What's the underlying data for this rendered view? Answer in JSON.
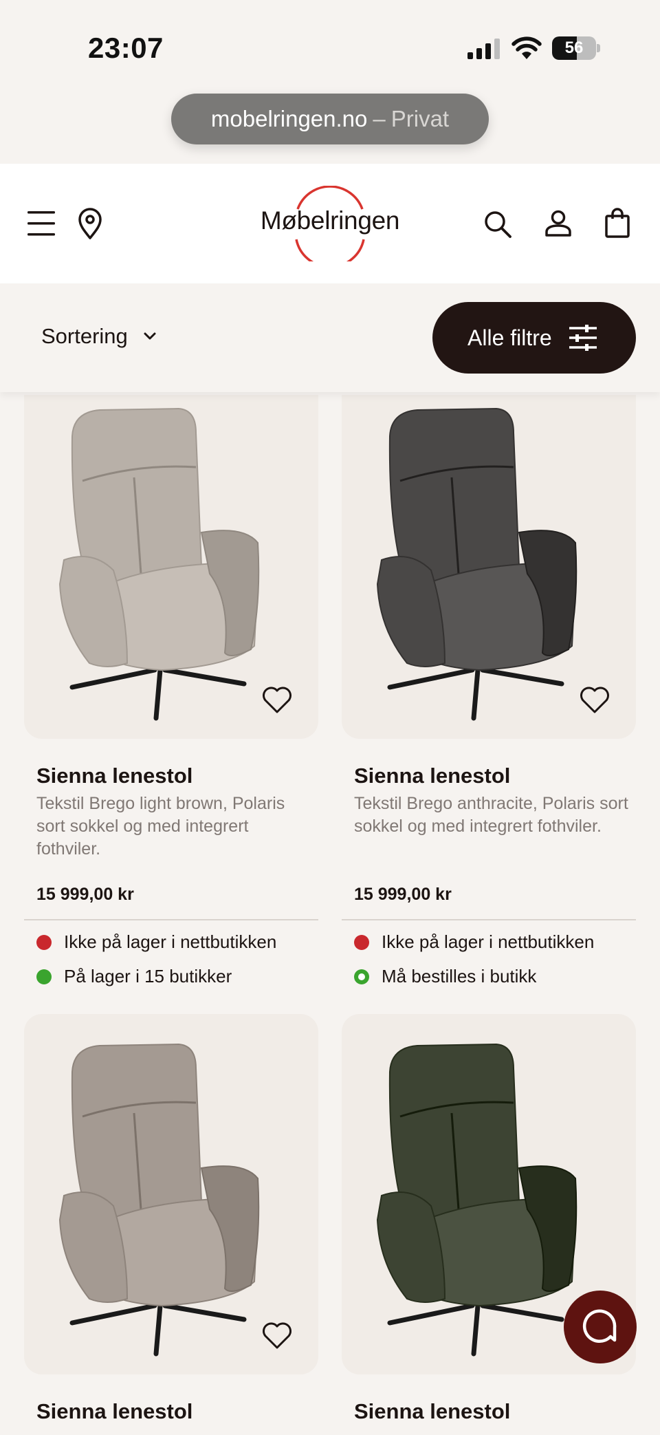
{
  "status_bar": {
    "time": "23:07",
    "battery_level": "56",
    "battery_fraction": 0.56
  },
  "browser": {
    "domain": "mobelringen.no",
    "separator": "–",
    "mode": "Privat"
  },
  "header": {
    "logo_text": "Møbelringen",
    "brand_color": "#d9352f"
  },
  "toolbar": {
    "sort_label": "Sortering",
    "filter_label": "Alle filtre",
    "filter_bg": "#221513"
  },
  "products": [
    {
      "title": "Sienna lenestol",
      "description": "Tekstil Brego light brown, Polaris sort sokkel og med integrert fothviler.",
      "price": "15 999,00 kr",
      "stock_online": "Ikke på lager i nettbutikken",
      "stock_store": "På lager i 15 butikker",
      "chair_color": "#b8b0a8"
    },
    {
      "title": "Sienna lenestol",
      "description": "Tekstil Brego anthracite, Polaris sort sokkel og med integrert fothviler.",
      "price": "15 999,00 kr",
      "stock_online": "Ikke på lager i nettbutikken",
      "stock_store": "Må bestilles i butikk",
      "chair_color": "#4a4847"
    },
    {
      "title": "Sienna lenestol",
      "chair_color": "#a49a92"
    },
    {
      "title": "Sienna lenestol",
      "chair_color": "#3d4433"
    }
  ],
  "colors": {
    "stock_red": "#c9282d",
    "stock_green": "#3aa42e",
    "chat_bg": "#5e1310"
  },
  "icons": [
    "menu-icon",
    "location-pin-icon",
    "search-icon",
    "user-icon",
    "shopping-bag-icon",
    "chevron-down-icon",
    "sliders-icon",
    "heart-icon",
    "chat-icon"
  ]
}
